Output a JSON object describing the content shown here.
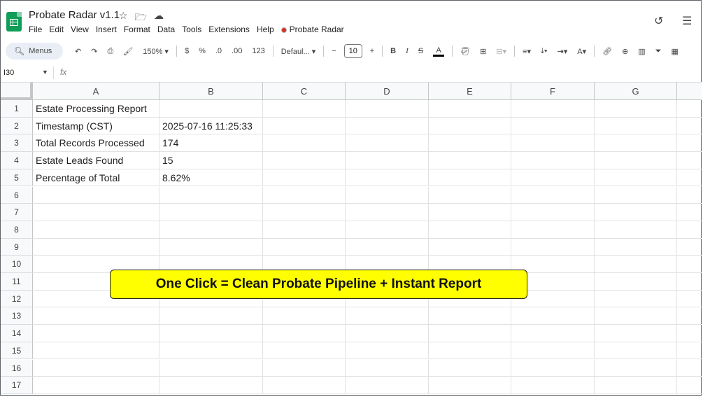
{
  "app": {
    "title": "Probate Radar v1.1",
    "title_icons": [
      "star-icon",
      "move-folder-icon",
      "cloud-status-icon"
    ],
    "header_right_icons": [
      "version-history-icon",
      "comments-icon"
    ]
  },
  "menubar": {
    "items": [
      "File",
      "Edit",
      "View",
      "Insert",
      "Format",
      "Data",
      "Tools",
      "Extensions",
      "Help"
    ],
    "addon_label": "Probate Radar"
  },
  "toolbar": {
    "menus_label": "Menus",
    "zoom": "150%",
    "currency": "$",
    "percent": "%",
    "decrease_decimal": ".0",
    "increase_decimal": ".00",
    "number_format": "123",
    "font_family": "Defaul...",
    "font_size": "10",
    "minus": "−",
    "plus": "+",
    "bold": "B",
    "italic": "I",
    "strikethrough": "S",
    "text_color": "A"
  },
  "formula_bar": {
    "name_box": "I30",
    "fx": "fx"
  },
  "sheet": {
    "columns": [
      "A",
      "B",
      "C",
      "D",
      "E",
      "F",
      "G"
    ],
    "rows": [
      "1",
      "2",
      "3",
      "4",
      "5",
      "6",
      "7",
      "8",
      "9",
      "10",
      "11",
      "12",
      "13",
      "14",
      "15",
      "16",
      "17"
    ],
    "cells": [
      [
        "Estate Processing Report",
        ""
      ],
      [
        "Timestamp (CST)",
        "2025-07-16 11:25:33"
      ],
      [
        "Total Records Processed",
        "174"
      ],
      [
        "Estate Leads Found",
        "15"
      ],
      [
        "Percentage of Total",
        "8.62%"
      ]
    ]
  },
  "callout": {
    "text": "One Click = Clean Probate Pipeline + Instant Report",
    "background": "#ffff00"
  },
  "colors": {
    "brand_green": "#0f9d58",
    "toolbar_pill": "#e9eef6",
    "header_bg": "#f8f9fa"
  }
}
